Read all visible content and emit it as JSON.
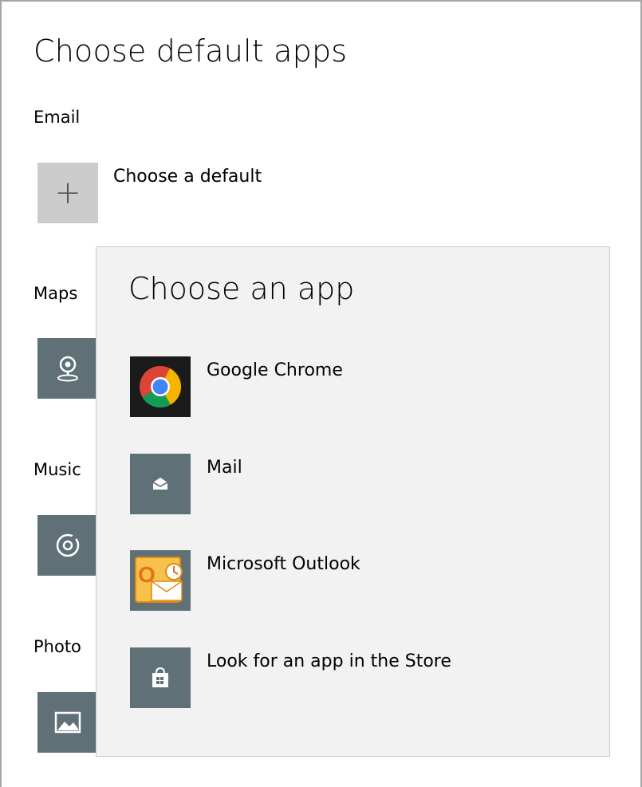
{
  "page": {
    "title": "Choose default apps",
    "default_text": "Choose a default"
  },
  "sections": [
    {
      "label": "Email",
      "icon": "plus-icon"
    },
    {
      "label": "Maps",
      "icon": "maps-icon"
    },
    {
      "label": "Music",
      "icon": "music-icon"
    },
    {
      "label": "Photo",
      "icon": "photo-icon"
    }
  ],
  "flyout": {
    "title": "Choose an app",
    "items": [
      {
        "label": "Google Chrome",
        "icon": "chrome-icon"
      },
      {
        "label": "Mail",
        "icon": "mail-icon"
      },
      {
        "label": "Microsoft Outlook",
        "icon": "outlook-icon"
      },
      {
        "label": "Look for an app in the Store",
        "icon": "store-icon"
      }
    ]
  },
  "colors": {
    "tile_bg": "#5f7077",
    "add_tile_bg": "#cccccc",
    "flyout_bg": "#f2f2f2"
  }
}
